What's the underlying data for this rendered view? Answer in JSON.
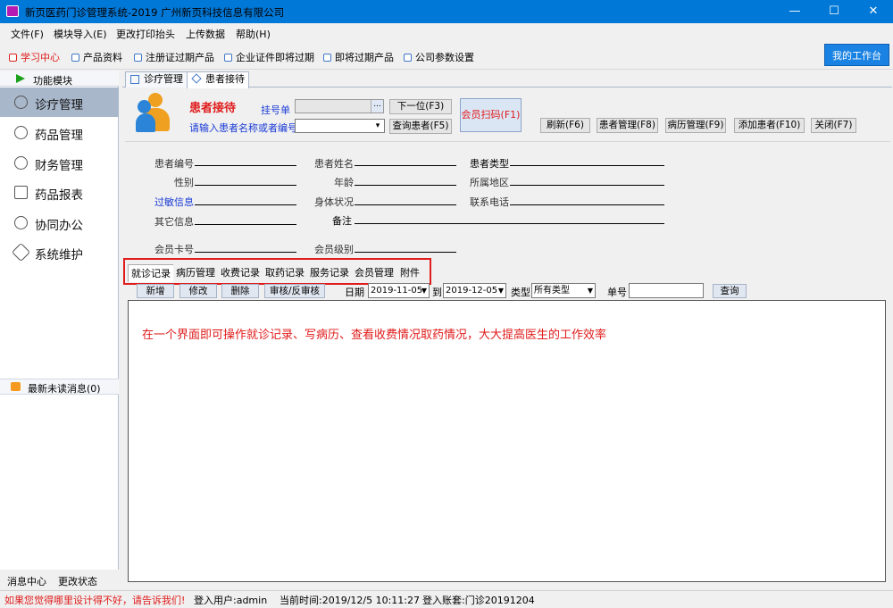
{
  "window": {
    "title": "新页医药门诊管理系统-2019 广州新页科技信息有限公司",
    "minimize": "—",
    "maximize": "☐",
    "close": "✕"
  },
  "menu": [
    "文件(F)",
    "模块导入(E)",
    "更改打印抬头",
    "上传数据",
    "帮助(H)"
  ],
  "toolbar": {
    "items": [
      "学习中心",
      "产品资料",
      "注册证过期产品",
      "企业证件即将过期",
      "即将过期产品",
      "公司参数设置"
    ],
    "workbench": "我的工作台"
  },
  "sidebar": {
    "header": "功能模块",
    "items": [
      "诊疗管理",
      "药品管理",
      "财务管理",
      "药品报表",
      "协同办公",
      "系统维护"
    ],
    "active_index": 0,
    "messages": "最新未读消息(0)",
    "bottom_left": "消息中心",
    "bottom_right": "更改状态"
  },
  "tabs": [
    "诊疗管理",
    "患者接待"
  ],
  "reception": {
    "title": "患者接待",
    "reg_label": "挂号单",
    "reg_value": "",
    "reg_btn": "...",
    "input_hint": "请输入患者名称或者编号",
    "prev_btn": "下一位(F3)",
    "query_btn": "查询患者(F5)",
    "scan_btn": "会员扫码(F1)",
    "actions": [
      "刷新(F6)",
      "患者管理(F8)",
      "病历管理(F9)",
      "添加患者(F10)",
      "关闭(F7)"
    ]
  },
  "fields": {
    "patient_no": "患者编号",
    "patient_name": "患者姓名",
    "patient_type": "患者类型",
    "gender": "性别",
    "age": "年龄",
    "region": "所属地区",
    "allergy": "过敏信息",
    "condition": "身体状况",
    "phone": "联系电话",
    "other": "其它信息",
    "remark": "备注",
    "card_no": "会员卡号",
    "member_level": "会员级别"
  },
  "record_tabs": [
    "就诊记录",
    "病历管理",
    "收费记录",
    "取药记录",
    "服务记录",
    "会员管理",
    "附件"
  ],
  "record_toolbar": {
    "add": "新增",
    "edit": "修改",
    "delete": "删除",
    "audit": "审核/反审核",
    "date_label": "日期",
    "date_from": "2019-11-05",
    "to_label": "到",
    "date_to": "2019-12-05",
    "type_label": "类型",
    "type_value": "所有类型",
    "order_label": "单号",
    "order_value": "",
    "query": "查询"
  },
  "note": "在一个界面即可操作就诊记录、写病历、查看收费情况取药情况，大大提高医生的工作效率",
  "status": {
    "feedback": "如果您觉得哪里设计得不好，请告诉我们!",
    "user": "登入用户:admin",
    "time": "当前时间:2019/12/5 10:11:27",
    "account": "登入账套:门诊20191204"
  },
  "colors": {
    "titlebar": "#0078d7",
    "accent_red": "#e01b1b",
    "link_blue": "#1a3bd6",
    "workbench": "#1a82e2"
  }
}
